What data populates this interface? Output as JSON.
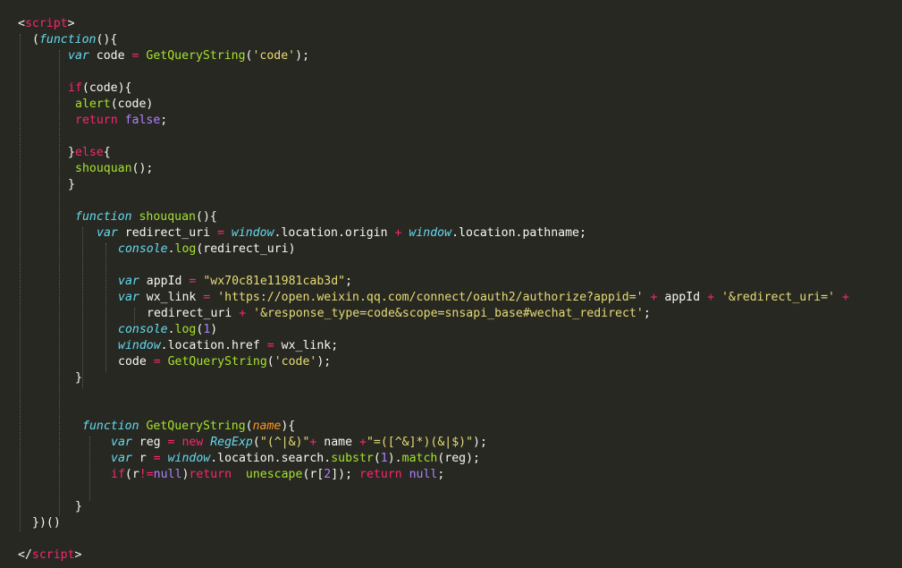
{
  "editor": {
    "lines": [
      {
        "indent": 20,
        "tokens": [
          [
            "p",
            "<"
          ],
          [
            "k",
            "script"
          ],
          [
            "p",
            ">"
          ]
        ]
      },
      {
        "indent": 36,
        "tokens": [
          [
            "p",
            "("
          ],
          [
            "v",
            "function"
          ],
          [
            "p",
            "(){"
          ]
        ]
      },
      {
        "indent": 76,
        "tokens": [
          [
            "v",
            "var"
          ],
          [
            "t",
            " code "
          ],
          [
            "k",
            "="
          ],
          [
            "t",
            " "
          ],
          [
            "f",
            "GetQueryString"
          ],
          [
            "t",
            "("
          ],
          [
            "s",
            "'code'"
          ],
          [
            "t",
            ");"
          ]
        ]
      },
      {
        "indent": 76,
        "tokens": []
      },
      {
        "indent": 76,
        "tokens": [
          [
            "k",
            "if"
          ],
          [
            "t",
            "(code){"
          ]
        ]
      },
      {
        "indent": 84,
        "tokens": [
          [
            "f",
            "alert"
          ],
          [
            "t",
            "(code)"
          ]
        ]
      },
      {
        "indent": 84,
        "tokens": [
          [
            "k",
            "return"
          ],
          [
            "t",
            " "
          ],
          [
            "n",
            "false"
          ],
          [
            "t",
            ";"
          ]
        ]
      },
      {
        "indent": 76,
        "tokens": []
      },
      {
        "indent": 76,
        "tokens": [
          [
            "t",
            "}"
          ],
          [
            "k",
            "else"
          ],
          [
            "t",
            "{"
          ]
        ]
      },
      {
        "indent": 84,
        "tokens": [
          [
            "f",
            "shouquan"
          ],
          [
            "t",
            "();"
          ]
        ]
      },
      {
        "indent": 76,
        "tokens": [
          [
            "t",
            "}"
          ]
        ]
      },
      {
        "indent": 76,
        "tokens": []
      },
      {
        "indent": 84,
        "tokens": [
          [
            "v",
            "function"
          ],
          [
            "t",
            " "
          ],
          [
            "f",
            "shouquan"
          ],
          [
            "t",
            "(){"
          ]
        ]
      },
      {
        "indent": 108,
        "tokens": [
          [
            "v",
            "var"
          ],
          [
            "t",
            " redirect_uri "
          ],
          [
            "k",
            "="
          ],
          [
            "t",
            " "
          ],
          [
            "v",
            "window"
          ],
          [
            "t",
            ".location.origin "
          ],
          [
            "k",
            "+"
          ],
          [
            "t",
            " "
          ],
          [
            "v",
            "window"
          ],
          [
            "t",
            ".location.pathname;"
          ]
        ]
      },
      {
        "indent": 132,
        "tokens": [
          [
            "v",
            "console"
          ],
          [
            "t",
            "."
          ],
          [
            "f",
            "log"
          ],
          [
            "t",
            "(redirect_uri)"
          ]
        ]
      },
      {
        "indent": 132,
        "tokens": []
      },
      {
        "indent": 132,
        "tokens": [
          [
            "v",
            "var"
          ],
          [
            "t",
            " appId "
          ],
          [
            "k",
            "="
          ],
          [
            "t",
            " "
          ],
          [
            "s",
            "\"wx70c81e11981cab3d\""
          ],
          [
            "t",
            ";"
          ]
        ]
      },
      {
        "indent": 132,
        "tokens": [
          [
            "v",
            "var"
          ],
          [
            "t",
            " wx_link "
          ],
          [
            "k",
            "="
          ],
          [
            "t",
            " "
          ],
          [
            "s",
            "'https://open.weixin.qq.com/connect/oauth2/authorize?appid='"
          ],
          [
            "t",
            " "
          ],
          [
            "k",
            "+"
          ],
          [
            "t",
            " appId "
          ],
          [
            "k",
            "+"
          ],
          [
            "t",
            " "
          ],
          [
            "s",
            "'&redirect_uri='"
          ],
          [
            "t",
            " "
          ],
          [
            "k",
            "+"
          ]
        ]
      },
      {
        "indent": 164,
        "tokens": [
          [
            "t",
            "redirect_uri "
          ],
          [
            "k",
            "+"
          ],
          [
            "t",
            " "
          ],
          [
            "s",
            "'&response_type=code&scope=snsapi_base#wechat_redirect'"
          ],
          [
            "t",
            ";"
          ]
        ]
      },
      {
        "indent": 132,
        "tokens": [
          [
            "v",
            "console"
          ],
          [
            "t",
            "."
          ],
          [
            "f",
            "log"
          ],
          [
            "t",
            "("
          ],
          [
            "n",
            "1"
          ],
          [
            "t",
            ")"
          ]
        ]
      },
      {
        "indent": 132,
        "tokens": [
          [
            "v",
            "window"
          ],
          [
            "t",
            ".location.href "
          ],
          [
            "k",
            "="
          ],
          [
            "t",
            " wx_link;"
          ]
        ]
      },
      {
        "indent": 132,
        "tokens": [
          [
            "t",
            "code "
          ],
          [
            "k",
            "="
          ],
          [
            "t",
            " "
          ],
          [
            "f",
            "GetQueryString"
          ],
          [
            "t",
            "("
          ],
          [
            "s",
            "'code'"
          ],
          [
            "t",
            ");"
          ]
        ]
      },
      {
        "indent": 84,
        "tokens": [
          [
            "t",
            "}"
          ]
        ]
      },
      {
        "indent": 84,
        "tokens": []
      },
      {
        "indent": 84,
        "tokens": []
      },
      {
        "indent": 92,
        "tokens": [
          [
            "v",
            "function"
          ],
          [
            "t",
            " "
          ],
          [
            "f",
            "GetQueryString"
          ],
          [
            "t",
            "("
          ],
          [
            "p",
            "name"
          ],
          [
            "t",
            "){"
          ]
        ]
      },
      {
        "indent": 124,
        "tokens": [
          [
            "v",
            "var"
          ],
          [
            "t",
            " reg "
          ],
          [
            "k",
            "="
          ],
          [
            "t",
            " "
          ],
          [
            "k",
            "new"
          ],
          [
            "t",
            " "
          ],
          [
            "v",
            "RegExp"
          ],
          [
            "t",
            "("
          ],
          [
            "s",
            "\"(^|&)\""
          ],
          [
            "k",
            "+"
          ],
          [
            "t",
            " name "
          ],
          [
            "k",
            "+"
          ],
          [
            "s",
            "\"=([^&]*)(&|$)\""
          ],
          [
            "t",
            ");"
          ]
        ]
      },
      {
        "indent": 124,
        "tokens": [
          [
            "v",
            "var"
          ],
          [
            "t",
            " r "
          ],
          [
            "k",
            "="
          ],
          [
            "t",
            " "
          ],
          [
            "v",
            "window"
          ],
          [
            "t",
            ".location.search."
          ],
          [
            "f",
            "substr"
          ],
          [
            "t",
            "("
          ],
          [
            "n",
            "1"
          ],
          [
            "t",
            ")."
          ],
          [
            "f",
            "match"
          ],
          [
            "t",
            "(reg);"
          ]
        ]
      },
      {
        "indent": 124,
        "tokens": [
          [
            "k",
            "if"
          ],
          [
            "t",
            "(r"
          ],
          [
            "k",
            "!="
          ],
          [
            "n",
            "null"
          ],
          [
            "t",
            ")"
          ],
          [
            "k",
            "return"
          ],
          [
            "t",
            "  "
          ],
          [
            "f",
            "unescape"
          ],
          [
            "t",
            "(r["
          ],
          [
            "n",
            "2"
          ],
          [
            "t",
            "]); "
          ],
          [
            "k",
            "return"
          ],
          [
            "t",
            " "
          ],
          [
            "n",
            "null"
          ],
          [
            "t",
            ";"
          ]
        ]
      },
      {
        "indent": 124,
        "tokens": []
      },
      {
        "indent": 84,
        "tokens": [
          [
            "t",
            "}"
          ]
        ]
      },
      {
        "indent": 36,
        "tokens": [
          [
            "t",
            "})()"
          ]
        ]
      },
      {
        "indent": 20,
        "tokens": []
      },
      {
        "indent": 20,
        "tokens": [
          [
            "p",
            "</"
          ],
          [
            "k",
            "script"
          ],
          [
            "p",
            ">"
          ]
        ]
      }
    ]
  }
}
